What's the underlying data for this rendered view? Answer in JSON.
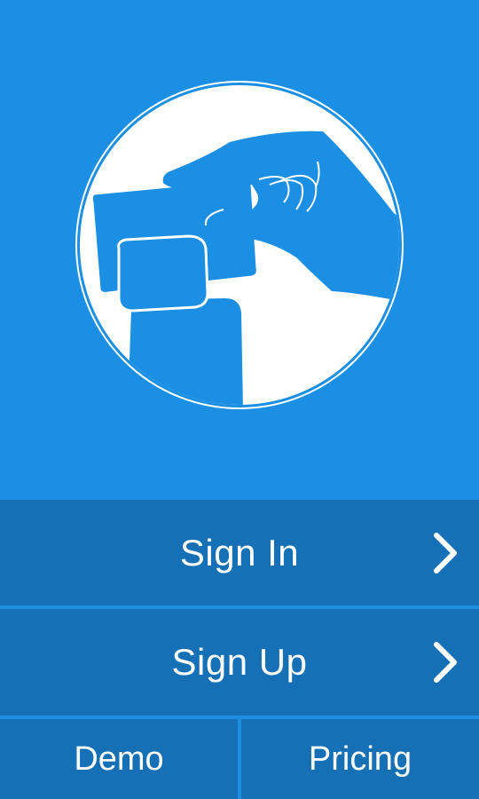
{
  "colors": {
    "background": "#1a8fe3",
    "button": "#1570b6",
    "divider": "#1e8ee0",
    "text": "#ffffff"
  },
  "hero": {
    "illustration": "hand-swiping-card-reader-icon"
  },
  "menu": {
    "sign_in_label": "Sign In",
    "sign_up_label": "Sign Up",
    "demo_label": "Demo",
    "pricing_label": "Pricing",
    "chevron_icon": "chevron-right-icon"
  }
}
